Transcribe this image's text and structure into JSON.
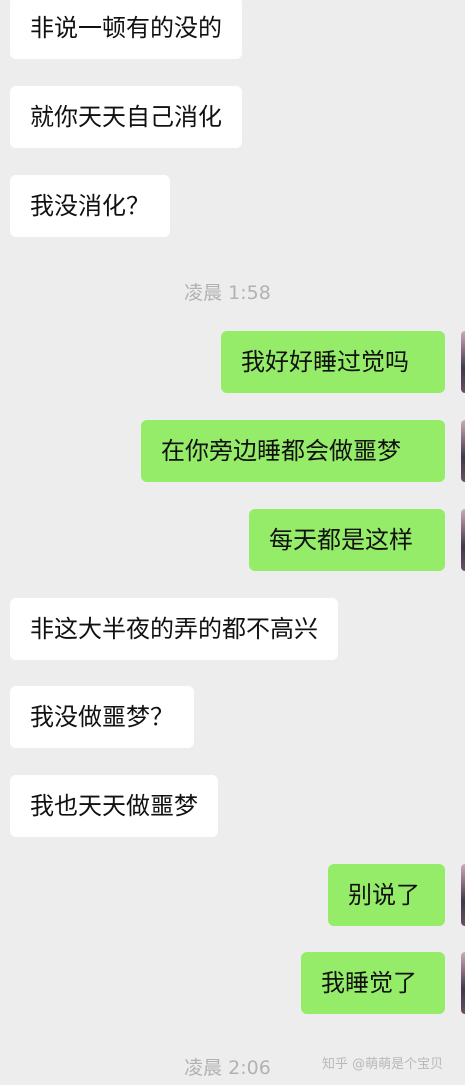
{
  "messages": [
    {
      "side": "in",
      "text": "非说一顿有的没的"
    },
    {
      "side": "in",
      "text": "就你天天自己消化"
    },
    {
      "side": "in",
      "text": "我没消化？"
    },
    {
      "side": "time",
      "text": "凌晨 1:58"
    },
    {
      "side": "out",
      "text": "我好好睡过觉吗"
    },
    {
      "side": "out",
      "text": "在你旁边睡都会做噩梦"
    },
    {
      "side": "out",
      "text": "每天都是这样"
    },
    {
      "side": "in",
      "text": "非这大半夜的弄的都不高兴"
    },
    {
      "side": "in",
      "text": "我没做噩梦？"
    },
    {
      "side": "in",
      "text": "我也天天做噩梦"
    },
    {
      "side": "out",
      "text": "别说了"
    },
    {
      "side": "out",
      "text": "我睡觉了"
    },
    {
      "side": "time",
      "text": "凌晨 2:06"
    }
  ],
  "watermark": "知乎 @萌萌是个宝贝",
  "colors": {
    "background": "#ededed",
    "incoming_bubble": "#ffffff",
    "outgoing_bubble": "#95ec69",
    "timestamp_text": "#b2b2b2"
  }
}
